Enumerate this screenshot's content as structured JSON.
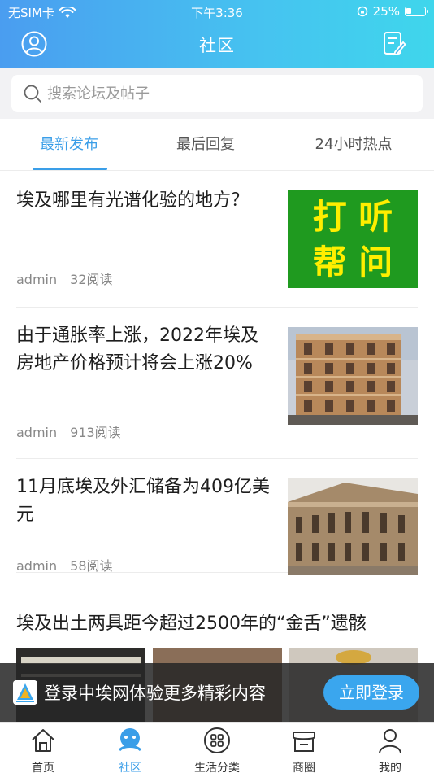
{
  "status_bar": {
    "carrier": "无SIM卡",
    "time": "下午3:36",
    "battery": "25%"
  },
  "nav": {
    "title": "社区"
  },
  "search": {
    "placeholder": "搜索论坛及帖子"
  },
  "tabs": [
    {
      "label": "最新发布",
      "active": true
    },
    {
      "label": "最后回复",
      "active": false
    },
    {
      "label": "24小时热点",
      "active": false
    }
  ],
  "articles": [
    {
      "title": "埃及哪里有光谱化验的地方？",
      "author": "admin",
      "reads": "32阅读",
      "thumb_text": [
        "打 听",
        "帮 问"
      ]
    },
    {
      "title": "由于通胀率上涨，2022年埃及房地产价格预计将会上涨20%",
      "author": "admin",
      "reads": "913阅读"
    },
    {
      "title": "11月底埃及外汇储备为409亿美元",
      "author": "admin",
      "reads": "58阅读"
    },
    {
      "title": "埃及出土两具距今超过2500年的“金舌”遗骸"
    }
  ],
  "login_bar": {
    "text": "登录中埃网体验更多精彩内容",
    "button": "立即登录"
  },
  "tabbar": [
    {
      "label": "首页",
      "icon": "home-icon",
      "active": false
    },
    {
      "label": "社区",
      "icon": "community-icon",
      "active": true
    },
    {
      "label": "生活分类",
      "icon": "category-icon",
      "active": false
    },
    {
      "label": "商圈",
      "icon": "shop-icon",
      "active": false
    },
    {
      "label": "我的",
      "icon": "profile-icon",
      "active": false
    }
  ],
  "colors": {
    "accent": "#3a9ee8",
    "header_start": "#4a9df0",
    "header_end": "#3fd6ec",
    "thumb_green": "#1f9a1f",
    "thumb_yellow": "#ffee00"
  }
}
